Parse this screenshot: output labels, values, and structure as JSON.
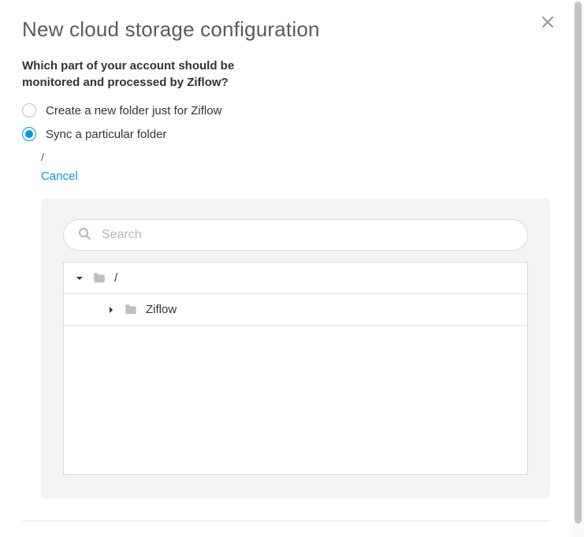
{
  "dialog": {
    "title": "New cloud storage configuration",
    "question": "Which part of your account should be monitored and processed by Ziflow?"
  },
  "options": {
    "create_folder_label": "Create a new folder just for Ziflow",
    "sync_folder_label": "Sync a particular folder",
    "selected": "sync"
  },
  "sync": {
    "path": "/",
    "cancel_label": "Cancel"
  },
  "search": {
    "placeholder": "Search",
    "value": ""
  },
  "tree": {
    "root_label": "/",
    "root_expanded": true,
    "children": [
      {
        "label": "Ziflow",
        "expanded": false
      }
    ]
  },
  "colors": {
    "accent": "#0099e5",
    "panel_bg": "#f3f3f3"
  }
}
